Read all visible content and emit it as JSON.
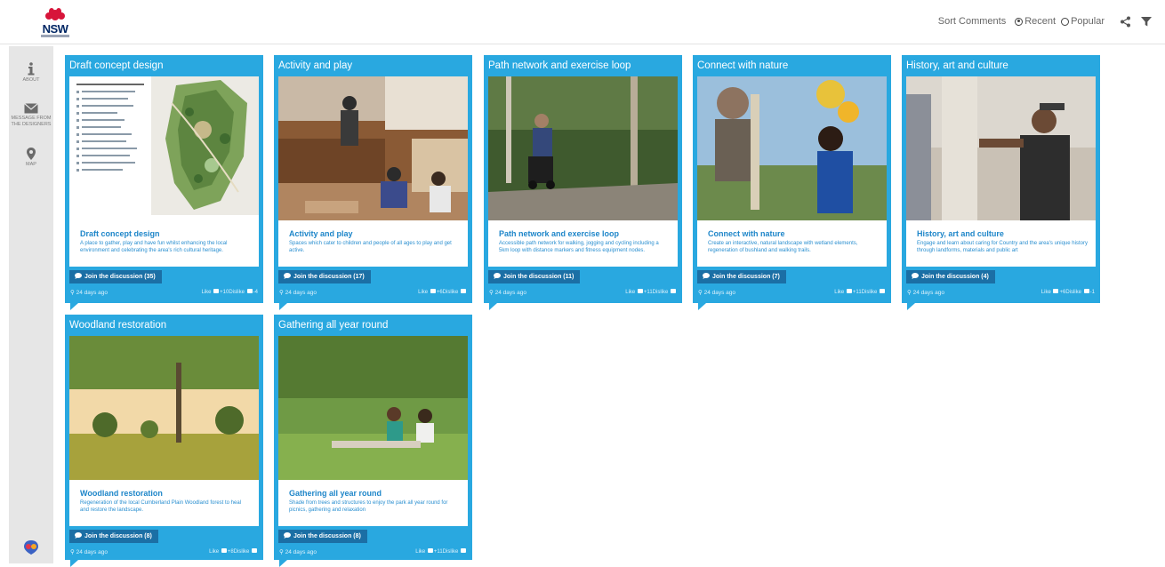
{
  "header": {
    "logo_text": "NSW",
    "sort_label": "Sort Comments",
    "sort_recent": "Recent",
    "sort_popular": "Popular",
    "share_icon": "share-icon",
    "filter_icon": "filter-icon"
  },
  "sidebar": {
    "about": "ABOUT",
    "message": "MESSAGE FROM THE DESIGNERS",
    "map": "MAP"
  },
  "colors": {
    "card": "#29a8e0",
    "button": "#1b6fa5",
    "heading": "#1e86c9"
  },
  "cards": [
    {
      "title": "Draft concept design",
      "heading": "Draft concept design",
      "desc": "A place to gather, play and have fun whilst enhancing the local environment and celebrating the area's rich cultural heritage.",
      "join": "Join the discussion (35)",
      "age": "24 days ago",
      "like_label": "Like",
      "likes": "+10",
      "dislike_label": "Dislike",
      "dislikes": "-4"
    },
    {
      "title": "Activity and play",
      "heading": "Activity and play",
      "desc": "Spaces which cater to children and people of all ages to play and get active.",
      "join": "Join the discussion (17)",
      "age": "24 days ago",
      "like_label": "Like",
      "likes": "+6",
      "dislike_label": "Dislike",
      "dislikes": ""
    },
    {
      "title": "Path network and exercise loop",
      "heading": "Path network and exercise loop",
      "desc": "Accessible path network for walking, jogging and cycling including a 5km loop with distance markers and fitness equipment nodes.",
      "join": "Join the discussion (11)",
      "age": "24 days ago",
      "like_label": "Like",
      "likes": "+11",
      "dislike_label": "Dislike",
      "dislikes": ""
    },
    {
      "title": "Connect with nature",
      "heading": "Connect with nature",
      "desc": "Create an interactive, natural landscape with wetland elements, regeneration of bushland and walking trails.",
      "join": "Join the discussion (7)",
      "age": "24 days ago",
      "like_label": "Like",
      "likes": "+11",
      "dislike_label": "Dislike",
      "dislikes": ""
    },
    {
      "title": "History, art and culture",
      "heading": "History, art and culture",
      "desc": "Engage and learn about caring for Country and the area's unique history through landforms, materials and public art",
      "join": "Join the discussion (4)",
      "age": "24 days ago",
      "like_label": "Like",
      "likes": "+6",
      "dislike_label": "Dislike",
      "dislikes": "-1"
    },
    {
      "title": "Woodland restoration",
      "heading": "Woodland restoration",
      "desc": "Regeneration of the local Cumberland Plain Woodland forest to heal and restore the landscape.",
      "join": "Join the discussion (8)",
      "age": "24 days ago",
      "like_label": "Like",
      "likes": "+8",
      "dislike_label": "Dislike",
      "dislikes": ""
    },
    {
      "title": "Gathering all year round",
      "heading": "Gathering all year round",
      "desc": "Shade from trees and structures to enjoy the park all year round for picnics, gathering and relaxation",
      "join": "Join the discussion (8)",
      "age": "24 days ago",
      "like_label": "Like",
      "likes": "+11",
      "dislike_label": "Dislike",
      "dislikes": ""
    }
  ]
}
